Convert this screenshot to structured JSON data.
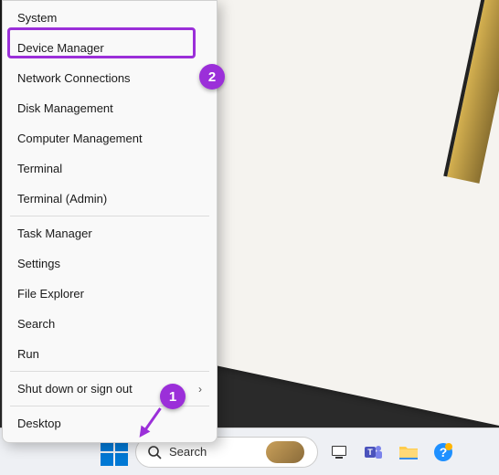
{
  "context_menu": {
    "items": [
      {
        "label": "System"
      },
      {
        "label": "Device Manager",
        "highlighted": true
      },
      {
        "label": "Network Connections"
      },
      {
        "label": "Disk Management"
      },
      {
        "label": "Computer Management"
      },
      {
        "label": "Terminal"
      },
      {
        "label": "Terminal (Admin)"
      }
    ],
    "items2": [
      {
        "label": "Task Manager"
      },
      {
        "label": "Settings"
      },
      {
        "label": "File Explorer"
      },
      {
        "label": "Search"
      },
      {
        "label": "Run"
      }
    ],
    "items3": [
      {
        "label": "Shut down or sign out",
        "submenu": true
      }
    ],
    "items4": [
      {
        "label": "Desktop"
      }
    ]
  },
  "annotations": {
    "step1": "1",
    "step2": "2"
  },
  "taskbar": {
    "search_label": "Search"
  },
  "colors": {
    "accent": "#9b2fd9",
    "win_blue": "#0078d4"
  }
}
